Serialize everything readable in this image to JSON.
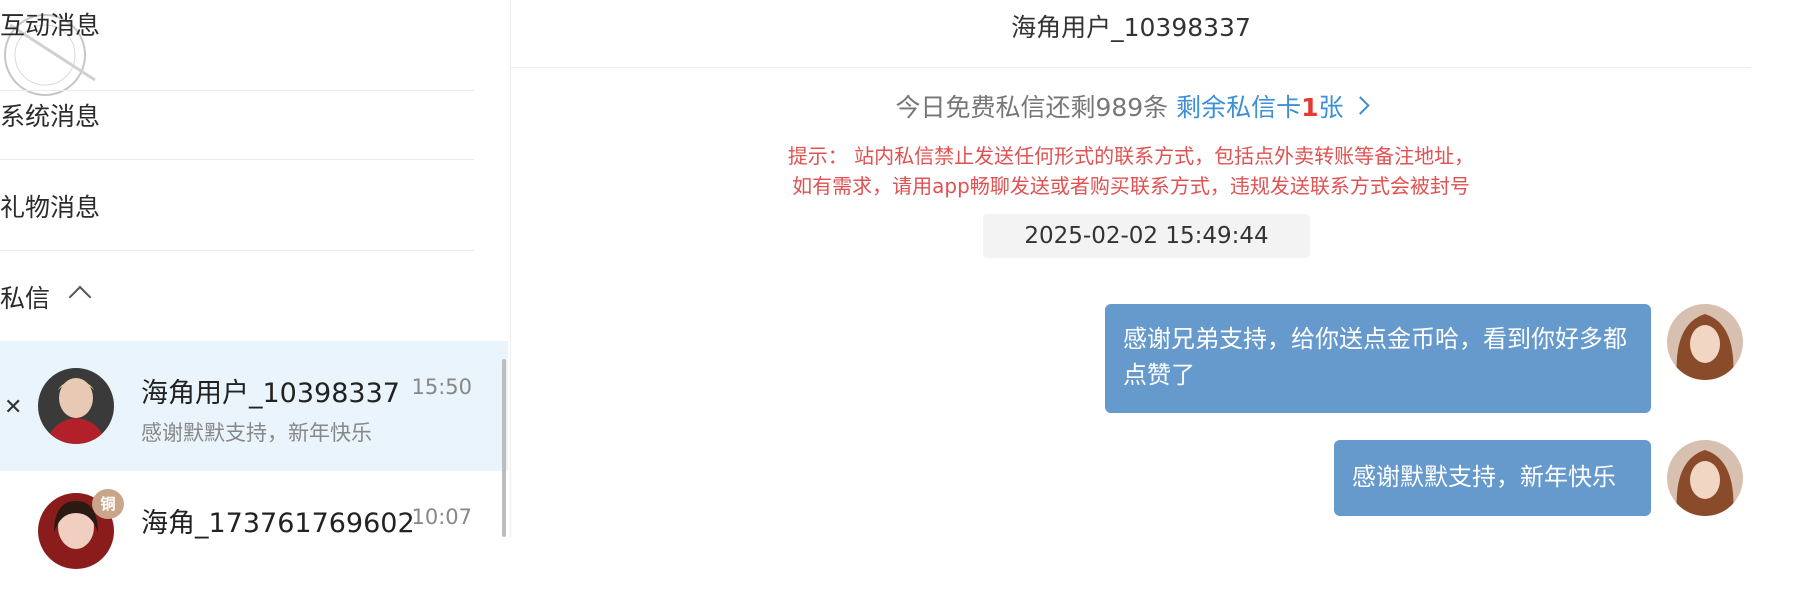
{
  "sidebar": {
    "categories": [
      {
        "label": "互动消息"
      },
      {
        "label": "系统消息"
      },
      {
        "label": "礼物消息"
      },
      {
        "label": "私信"
      }
    ],
    "conversations": [
      {
        "name": "海角用户_10398337",
        "time": "15:50",
        "preview": "感谢默默支持，新年快乐",
        "selected": true
      },
      {
        "name": "海角_173761769602",
        "time": "10:07",
        "badge": "铜"
      }
    ]
  },
  "chat": {
    "title": "海角用户_10398337",
    "quota_text": "今日免费私信还剩989条",
    "card_prefix": "剩余私信卡",
    "card_count": "1",
    "card_suffix": "张",
    "warning_line1": "提示： 站内私信禁止发送任何形式的联系方式，包括点外卖转账等备注地址，",
    "warning_line2": "如有需求，请用app畅聊发送或者购买联系方式，违规发送联系方式会被封号",
    "timestamp": "2025-02-02 15:49:44",
    "messages": [
      {
        "text": "感谢兄弟支持，给你送点金币哈，看到你好多都点赞了",
        "from": "me"
      },
      {
        "text": "感谢默默支持，新年快乐",
        "from": "me"
      }
    ]
  },
  "colors": {
    "selected_bg": "#e9f4fc",
    "bubble": "#6699cc",
    "link": "#3d8fd6",
    "warning": "#e05252"
  }
}
